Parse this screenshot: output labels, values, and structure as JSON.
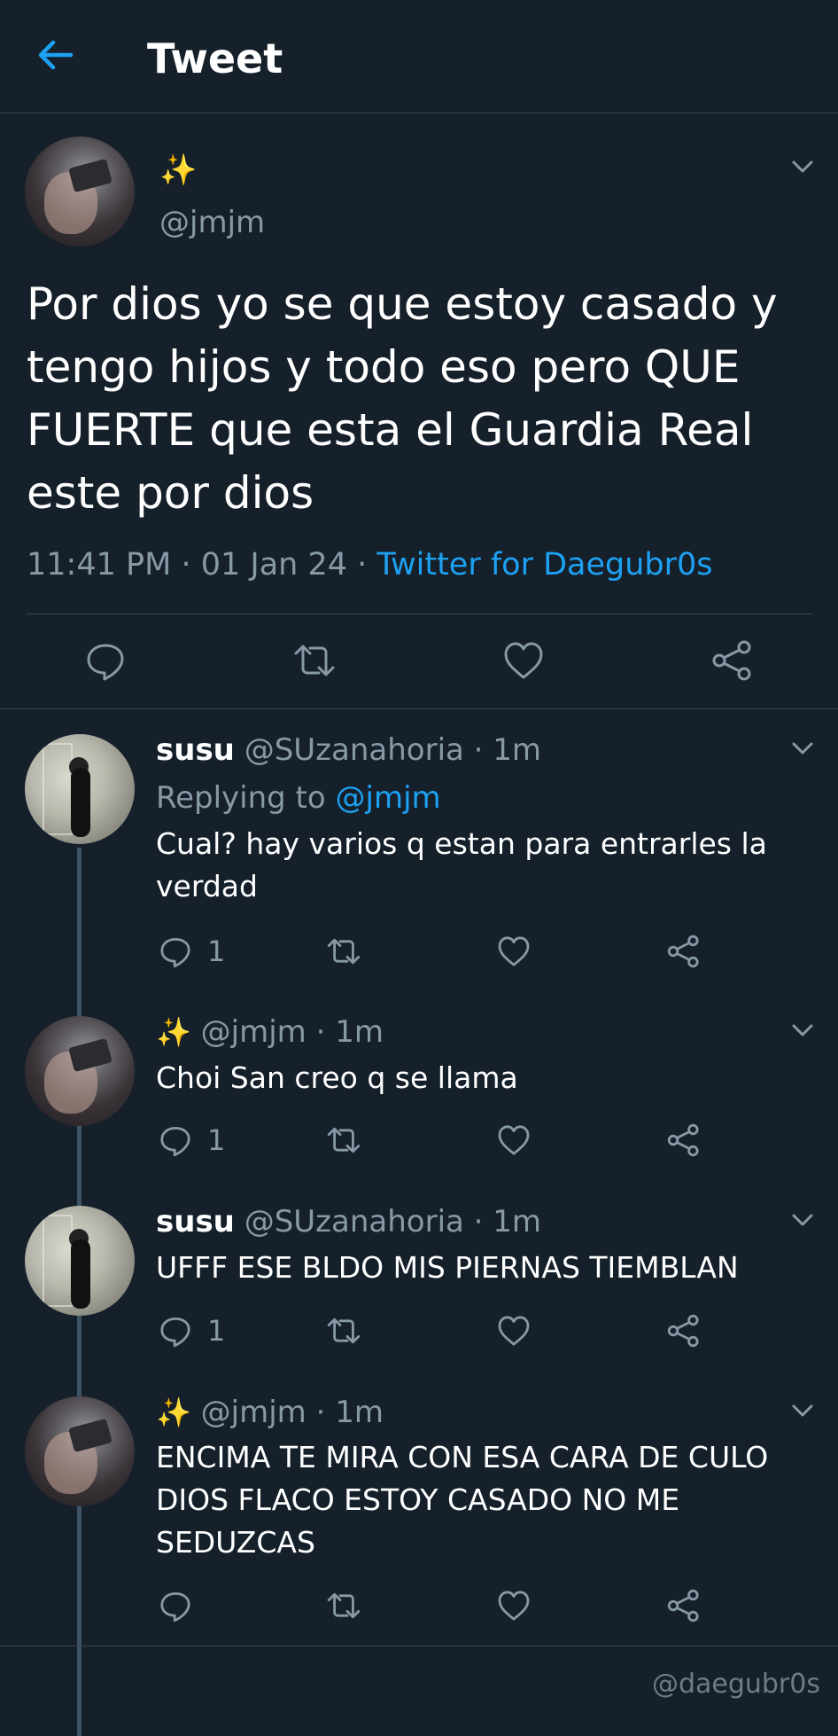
{
  "header": {
    "title": "Tweet"
  },
  "tweet": {
    "display_name": "✨",
    "handle": "@jmjm",
    "text": "Por dios yo se que estoy casado y tengo hijos y todo eso pero QUE FUERTE que esta el Guardia Real este por dios",
    "time": "11:41 PM",
    "date": "01 Jan 24",
    "dot": "·",
    "source": "Twitter for Daegubr0s"
  },
  "replies": [
    {
      "name": "susu",
      "handle": "@SUzanahoria",
      "time": "· 1m",
      "replying_label": "Replying to",
      "replying_to": "@jmjm",
      "text": "Cual? hay varios q estan para entrarles la verdad",
      "reply_count": "1"
    },
    {
      "name": "✨",
      "handle": "@jmjm",
      "time": "· 1m",
      "text": "Choi San creo q se llama",
      "reply_count": "1"
    },
    {
      "name": "susu",
      "handle": "@SUzanahoria",
      "time": "· 1m",
      "text": "UFFF ESE BLDO MIS PIERNAS TIEMBLAN",
      "reply_count": "1"
    },
    {
      "name": "✨",
      "handle": "@jmjm",
      "time": "· 1m",
      "text": "ENCIMA TE MIRA CON ESA CARA DE CULO DIOS FLACO ESTOY CASADO NO ME SEDUZCAS",
      "reply_count": ""
    }
  ],
  "watermark": "@daegubr0s",
  "colors": {
    "background": "#15202b",
    "accent": "#1da1f2",
    "muted": "#8899a6",
    "divider": "#38444d"
  },
  "icons": [
    "back-arrow-icon",
    "chevron-down-icon",
    "reply-icon",
    "retweet-icon",
    "like-icon",
    "share-icon"
  ]
}
